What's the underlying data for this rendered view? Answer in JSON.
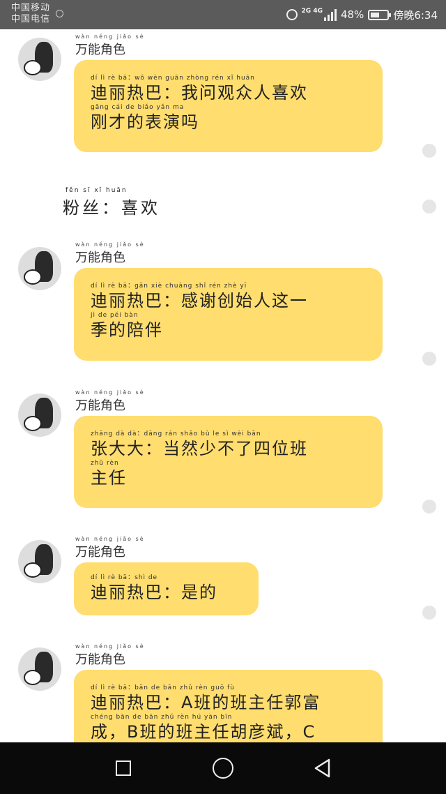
{
  "status": {
    "carrier1": "中国移动",
    "carrier2": "中国电信",
    "net": "2G 4G",
    "battery": "48%",
    "battery_level": 0.48,
    "time": "傍晚6:34"
  },
  "messages": [
    {
      "sender_py": "wàn néng jiǎo sè",
      "sender": "万能角色",
      "lines": [
        [
          "dí lì rè bā：wǒ wèn guān zhòng rén xǐ huān",
          "迪丽热巴：我问观众人喜欢"
        ],
        [
          "gāng cái de biǎo yǎn ma",
          "刚才的表演吗"
        ]
      ]
    },
    {
      "plain_py": "fěn sī    xǐ huān",
      "plain": "粉丝：喜欢"
    },
    {
      "sender_py": "wàn néng jiǎo sè",
      "sender": "万能角色",
      "lines": [
        [
          "dí lì rè bā：gǎn xiè chuàng shǐ rén zhè yī",
          "迪丽热巴：感谢创始人这一"
        ],
        [
          "jì de péi bàn",
          "季的陪伴"
        ]
      ]
    },
    {
      "sender_py": "wàn néng jiǎo sè",
      "sender": "万能角色",
      "lines": [
        [
          "zhāng dà dà：dāng rán shǎo bù le sì wèi bān",
          "张大大：当然少不了四位班"
        ],
        [
          "zhǔ rèn",
          "主任"
        ]
      ]
    },
    {
      "sender_py": "wàn néng jiǎo sè",
      "sender": "万能角色",
      "lines": [
        [
          "dí lì rè bā：shì de",
          "迪丽热巴：是的"
        ]
      ]
    },
    {
      "sender_py": "wàn néng jiǎo sè",
      "sender": "万能角色",
      "lines": [
        [
          "dí lì rè bā：bān de bān zhǔ rèn guō fù",
          "迪丽热巴：A班的班主任郭富"
        ],
        [
          "chéng  bān de bān zhǔ rèn hú yàn bīn",
          "成，B班的班主任胡彦斌，C"
        ]
      ]
    }
  ]
}
